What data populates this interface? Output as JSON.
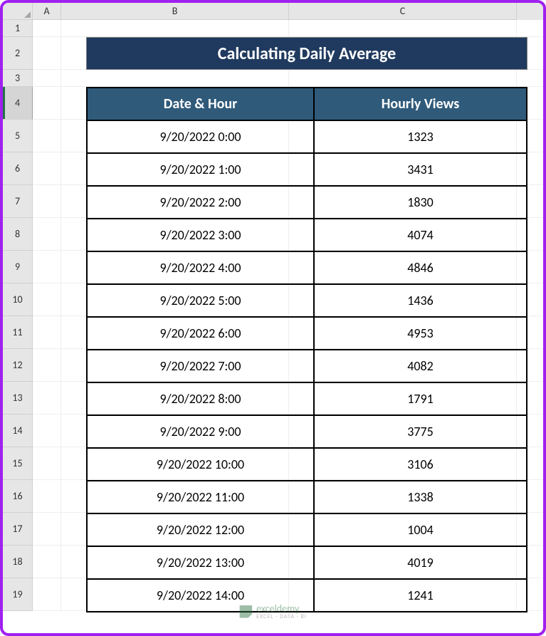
{
  "columns": {
    "A": "A",
    "B": "B",
    "C": "C"
  },
  "row_numbers": [
    "1",
    "2",
    "3",
    "4",
    "5",
    "6",
    "7",
    "8",
    "9",
    "10",
    "11",
    "12",
    "13",
    "14",
    "15",
    "16",
    "17",
    "18",
    "19"
  ],
  "selected_row": "4",
  "title": "Calculating Daily Average",
  "headers": {
    "date_hour": "Date & Hour",
    "hourly_views": "Hourly Views"
  },
  "rows": [
    {
      "dt": "9/20/2022 0:00",
      "views": "1323"
    },
    {
      "dt": "9/20/2022 1:00",
      "views": "3431"
    },
    {
      "dt": "9/20/2022 2:00",
      "views": "1830"
    },
    {
      "dt": "9/20/2022 3:00",
      "views": "4074"
    },
    {
      "dt": "9/20/2022 4:00",
      "views": "4846"
    },
    {
      "dt": "9/20/2022 5:00",
      "views": "1436"
    },
    {
      "dt": "9/20/2022 6:00",
      "views": "4953"
    },
    {
      "dt": "9/20/2022 7:00",
      "views": "4082"
    },
    {
      "dt": "9/20/2022 8:00",
      "views": "1791"
    },
    {
      "dt": "9/20/2022 9:00",
      "views": "3775"
    },
    {
      "dt": "9/20/2022 10:00",
      "views": "3106"
    },
    {
      "dt": "9/20/2022 11:00",
      "views": "1338"
    },
    {
      "dt": "9/20/2022 12:00",
      "views": "1004"
    },
    {
      "dt": "9/20/2022 13:00",
      "views": "4019"
    },
    {
      "dt": "9/20/2022 14:00",
      "views": "1241"
    }
  ],
  "watermark": {
    "brand": "exceldemy",
    "tag": "EXCEL · DATA · BI"
  }
}
